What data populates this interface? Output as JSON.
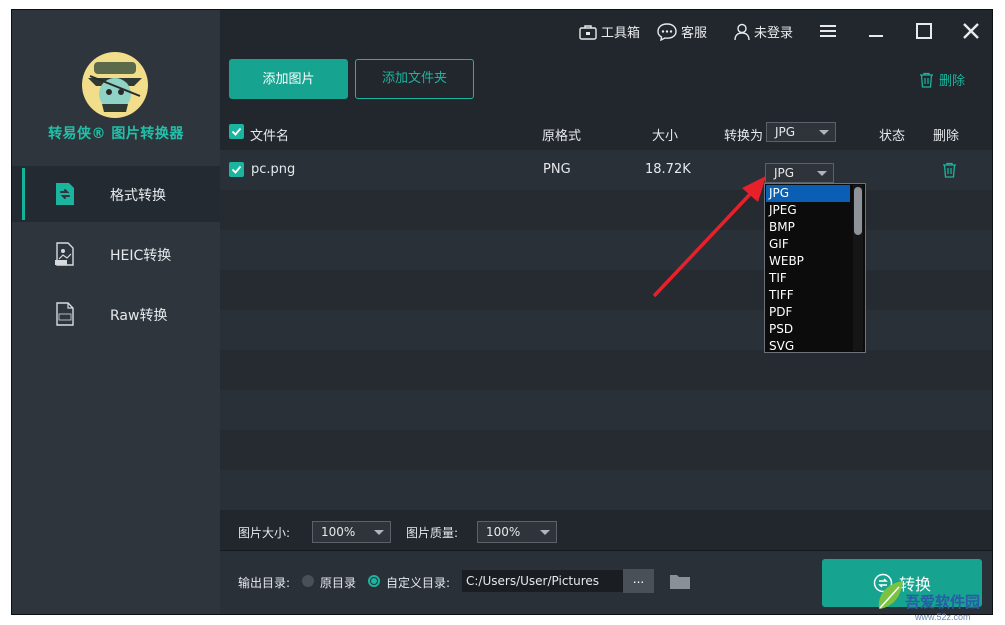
{
  "app": {
    "title": "转易侠® 图片转换器"
  },
  "titlebar": {
    "toolbox": "工具箱",
    "service": "客服",
    "login": "未登录"
  },
  "sidebar": {
    "items": [
      {
        "label": "格式转换",
        "icon": "format-convert-icon"
      },
      {
        "label": "HEIC转换",
        "icon": "heic-file-icon"
      },
      {
        "label": "Raw转换",
        "icon": "raw-file-icon"
      }
    ]
  },
  "toolbar": {
    "add_image": "添加图片",
    "add_folder": "添加文件夹",
    "delete": "删除"
  },
  "table": {
    "headers": {
      "filename": "文件名",
      "format": "原格式",
      "size": "大小",
      "convert_to": "转换为",
      "status": "状态",
      "delete": "删除"
    },
    "global_target": "JPG",
    "rows": [
      {
        "name": "pc.png",
        "format": "PNG",
        "size": "18.72K",
        "target": "JPG",
        "checked": true
      }
    ]
  },
  "dropdown": {
    "options": [
      "JPG",
      "JPEG",
      "BMP",
      "GIF",
      "WEBP",
      "TIF",
      "TIFF",
      "PDF",
      "PSD",
      "SVG"
    ],
    "selected": "JPG"
  },
  "bottom": {
    "image_size_label": "图片大小:",
    "image_size": "100%",
    "quality_label": "图片质量:",
    "quality": "100%",
    "output_label": "输出目录:",
    "original_dir": "原目录",
    "custom_dir": "自定义目录:",
    "path": "C:/Users/User/Pictures",
    "browse": "...",
    "convert": "转换"
  },
  "watermark": {
    "text": "吾爱软件园",
    "url": "www.52z.com"
  },
  "colors": {
    "accent": "#16a38f",
    "sidebar": "#2e353d",
    "main": "#22272d",
    "arrow": "#e8202a"
  }
}
